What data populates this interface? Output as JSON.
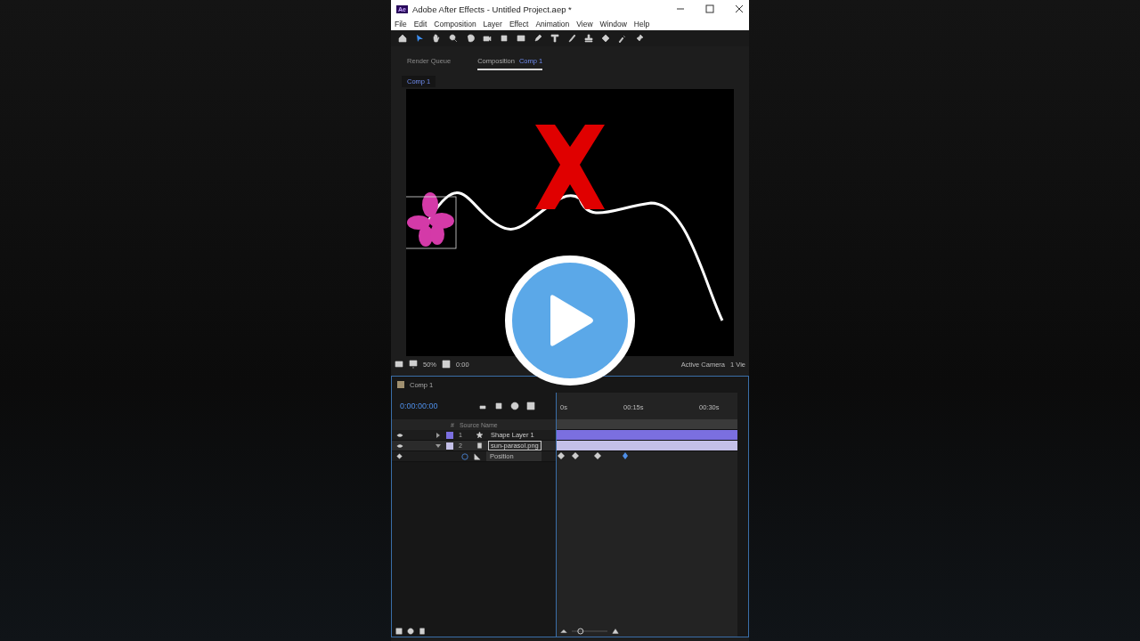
{
  "window": {
    "title": "Adobe After Effects - Untitled Project.aep *",
    "app_badge": "Ae"
  },
  "menu": [
    "File",
    "Edit",
    "Composition",
    "Layer",
    "Effect",
    "Animation",
    "View",
    "Window",
    "Help"
  ],
  "panel_tabs": [
    {
      "label": "Render Queue",
      "selected": false
    },
    {
      "label": "Composition",
      "comp": "Comp 1",
      "selected": true
    }
  ],
  "breadcrumb": "Comp 1",
  "viewer_bar": {
    "zoom": "50%",
    "time": "0:00",
    "camera": "Active Camera",
    "views": "1 Vie"
  },
  "timeline": {
    "tab": "Comp 1",
    "timecode": "0:00:00:00",
    "ruler": [
      "0s",
      "00:15s",
      "00:30s"
    ],
    "columns": [
      "#",
      "Source Name"
    ],
    "layers": [
      {
        "number": "1",
        "name": "Shape Layer 1",
        "color": "#7b6fe0",
        "expanded": false,
        "selected": false
      },
      {
        "number": "2",
        "name": "sun-parasol.png",
        "color": "#c4c0e8",
        "expanded": true,
        "selected": true
      }
    ],
    "property": "Position",
    "zoom_slider": {
      "level": 0.2
    }
  }
}
